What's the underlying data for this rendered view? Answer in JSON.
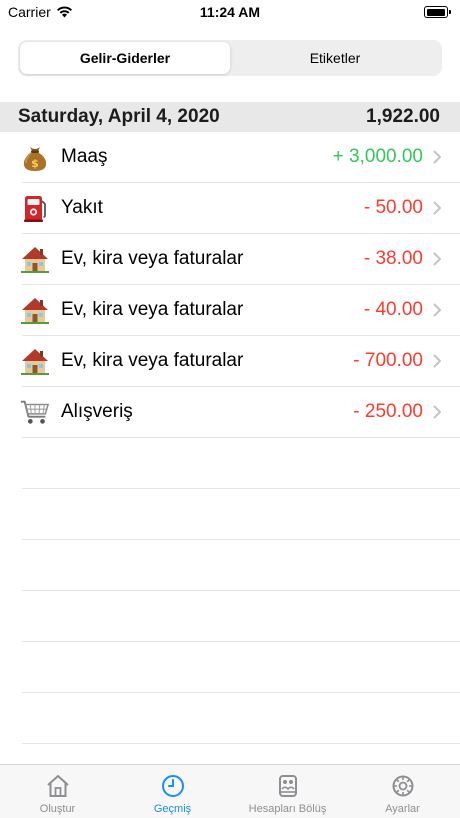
{
  "status_bar": {
    "carrier": "Carrier",
    "time": "11:24 AM"
  },
  "segmented": {
    "items": [
      {
        "label": "Gelir-Giderler",
        "active": true
      },
      {
        "label": "Etiketler",
        "active": false
      }
    ]
  },
  "section": {
    "date": "Saturday, April 4, 2020",
    "total": "1,922.00"
  },
  "transactions": [
    {
      "label": "Maaş",
      "amount": "+ 3,000.00",
      "type": "income",
      "icon": "money-bag-icon"
    },
    {
      "label": "Yakıt",
      "amount": "- 50.00",
      "type": "expense",
      "icon": "fuel-pump-icon"
    },
    {
      "label": "Ev, kira veya faturalar",
      "amount": "- 38.00",
      "type": "expense",
      "icon": "house-icon"
    },
    {
      "label": "Ev, kira veya faturalar",
      "amount": "- 40.00",
      "type": "expense",
      "icon": "house-icon"
    },
    {
      "label": "Ev, kira veya faturalar",
      "amount": "- 700.00",
      "type": "expense",
      "icon": "house-icon"
    },
    {
      "label": "Alışveriş",
      "amount": "- 250.00",
      "type": "expense",
      "icon": "shopping-cart-icon"
    }
  ],
  "tab_bar": {
    "items": [
      {
        "label": "Oluştur",
        "icon": "home-icon",
        "active": false
      },
      {
        "label": "Geçmiş",
        "icon": "clock-icon",
        "active": true
      },
      {
        "label": "Hesapları Bölüş",
        "icon": "split-bill-icon",
        "active": false
      },
      {
        "label": "Ayarlar",
        "icon": "gear-icon",
        "active": false
      }
    ]
  },
  "colors": {
    "income": "#34c759",
    "expense": "#ff3b30",
    "accent": "#1a8cff",
    "tab_inactive": "#8e8e93"
  }
}
